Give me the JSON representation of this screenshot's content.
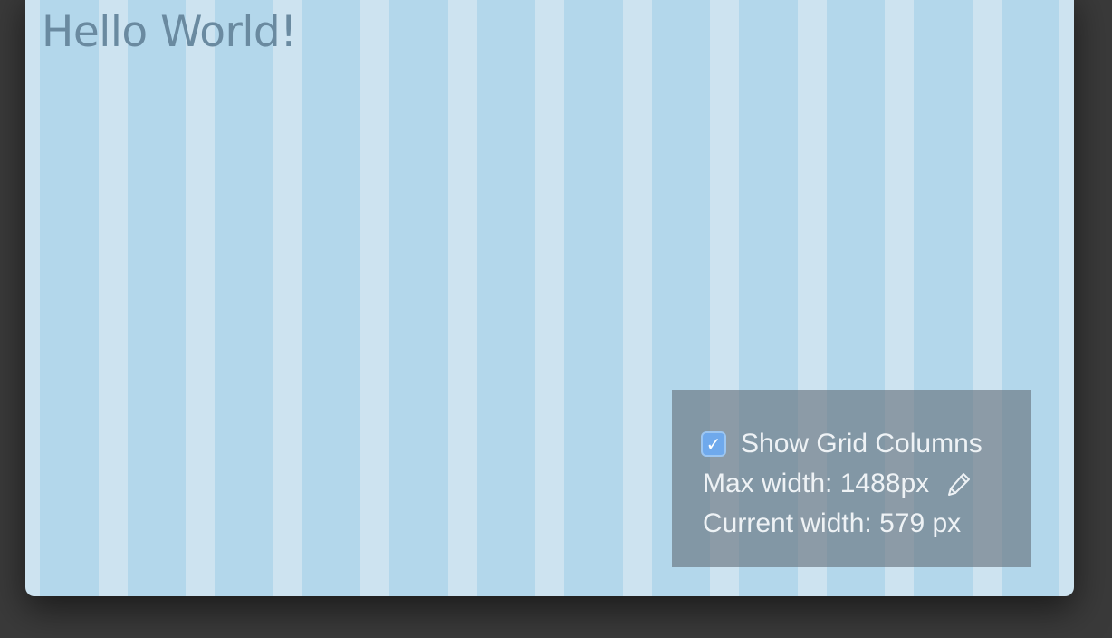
{
  "page": {
    "heading": "Hello World!"
  },
  "grid_panel": {
    "show_columns_label": "Show Grid Columns",
    "show_columns_checked": true,
    "checkbox_glyph": "✓",
    "max_width_label": "Max width: 1488px",
    "edit_icon": "pencil-icon",
    "current_width_label": "Current width: 579 px"
  },
  "colors": {
    "background": "#3a3a3a",
    "page_background": "#cde3f0",
    "grid_column": "#b3d7eb",
    "heading": "#6a8aa0",
    "checkbox_accent": "#6fa9ec"
  }
}
